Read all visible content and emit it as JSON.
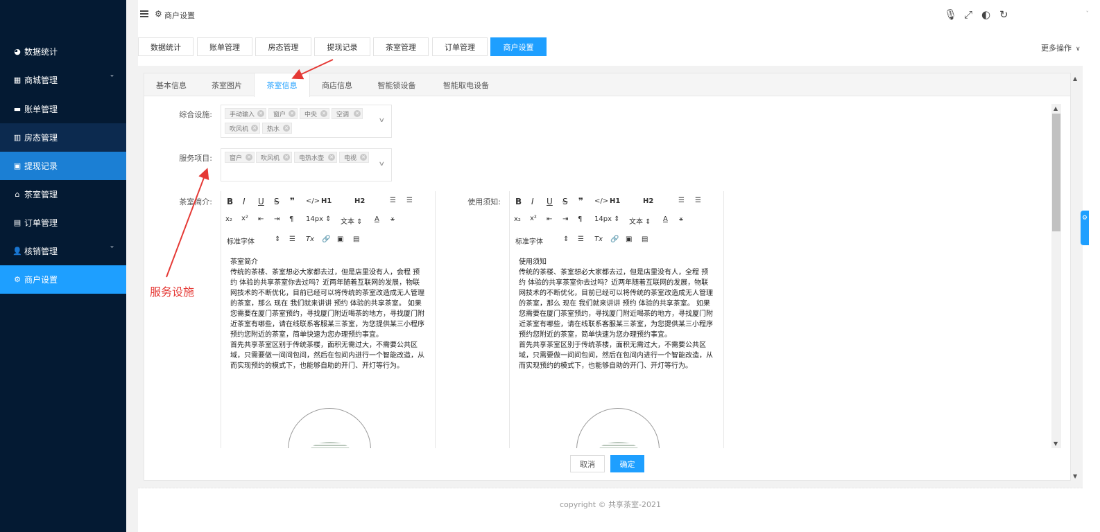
{
  "header": {
    "breadcrumb": "商户设置"
  },
  "sidebar": {
    "items": [
      {
        "label": "数据统计",
        "icon": "dashboard-icon"
      },
      {
        "label": "商城管理",
        "icon": "shop-icon",
        "has_children": true
      },
      {
        "label": "账单管理",
        "icon": "card-icon"
      },
      {
        "label": "房态管理",
        "icon": "building-icon"
      },
      {
        "label": "提现记录",
        "icon": "money-icon"
      },
      {
        "label": "茶室管理",
        "icon": "home-icon"
      },
      {
        "label": "订单管理",
        "icon": "list-icon"
      },
      {
        "label": "核销管理",
        "icon": "user-plus-icon",
        "has_children": true
      },
      {
        "label": "商户设置",
        "icon": "gear-icon"
      }
    ]
  },
  "top_tabs": [
    "数据统计",
    "账单管理",
    "房态管理",
    "提现记录",
    "茶室管理",
    "订单管理",
    "商户设置"
  ],
  "more_ops": "更多操作",
  "sub_tabs": [
    "基本信息",
    "茶室图片",
    "茶室信息",
    "商店信息",
    "智能锁设备",
    "智能取电设备"
  ],
  "form": {
    "facilities_label": "综合设施:",
    "facilities": [
      "手动输入",
      "窗户",
      "中央",
      "空调",
      "吹风机",
      "热水"
    ],
    "services_label": "服务项目:",
    "services": [
      "窗户",
      "吹风机",
      "电热水壶",
      "电视"
    ],
    "intro_label": "茶室简介:",
    "notice_label": "使用须知:"
  },
  "editor": {
    "font_size": "14px",
    "text_type": "文本",
    "font_family": "标准字体",
    "h1": "H1",
    "h2": "H2"
  },
  "intro_content": {
    "title": "茶室简介",
    "p1": "传统的茶楼、茶室想必大家都去过，但是店里没有人，会程  预约  体验的共享茶室你去过吗？近两年随着互联网的发展，物联网技术的不断优化，目前已经可以将传统的茶室改造成无人管理的茶室，那么  现在  我们就来讲讲  预约  体验的共享茶室。  如果您需要在厦门茶室预约，寻找厦门附近喝茶的地方，寻找厦门附近茶室有哪些，请在线联系客服某三茶室，为您提供某三小程序预约您附近的茶室，简单快速为您办理预约事宜。",
    "p2": "首先共享茶室区别于传统茶楼，面积无需过大，不需要公共区域，只需要做一间间包间，然后在包间内进行一个智能改造，从而实现预约的模式下，也能够自助的开门、开灯等行为。"
  },
  "notice_content": {
    "title": "使用须知",
    "p1": "传统的茶楼、茶室想必大家都去过，但是店里没有人，全程  预约  体验的共享茶室你去过吗？近两年随着互联网的发展，物联网技术的不断优化，目前已经可以将传统的茶室改造成无人管理的茶室，那么  现在  我们就来讲讲  预约  体验的共享茶室。  如果您需要在厦门茶室预约，寻找厦门附近喝茶的地方，寻找厦门附近茶室有哪些，请在线联系客服某三茶室，为您提供某三小程序预约您附近的茶室，简单快速为您办理预约事宜。",
    "p2": "首先共享茶室区别于传统茶楼，面积无需过大，不需要公共区域，只需要做一间间包间，然后在包间内进行一个智能改造，从而实现预约的模式下，也能够自助的开门、开灯等行为。"
  },
  "buttons": {
    "cancel": "取消",
    "ok": "确定"
  },
  "footer": "copyright © 共享茶室-2021",
  "annotation": "服务设施",
  "colors": {
    "sidebar_bg": "#041a33",
    "accent": "#1e9fff",
    "annotation": "#e53935"
  }
}
